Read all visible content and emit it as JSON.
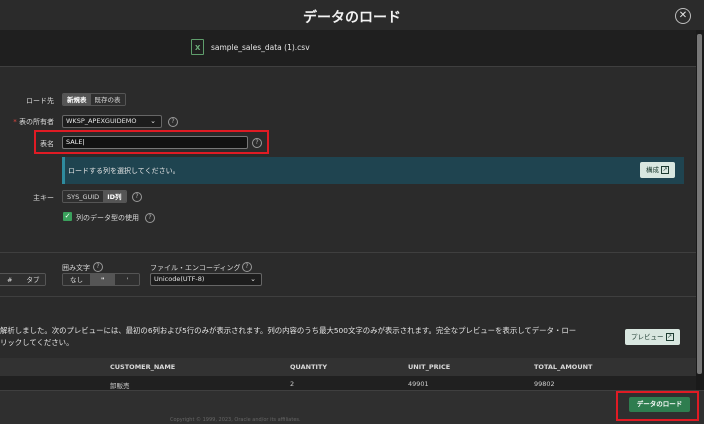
{
  "dialog": {
    "title": "データのロード",
    "close_glyph": "✕"
  },
  "file": {
    "name": "sample_sales_data (1).csv",
    "icon": "excel-file-icon",
    "icon_glyph": "X"
  },
  "load_to": {
    "label": "ロード先",
    "options": [
      "新規表",
      "既存の表"
    ],
    "selected": "新規表"
  },
  "owner": {
    "required_mark": "*",
    "label": "表の所有者",
    "value": "WKSP_APEXGUIDEMO"
  },
  "table_name": {
    "label": "表名",
    "value": "SALE"
  },
  "banner": {
    "text": "ロードする列を選択してください。",
    "button": "構成"
  },
  "primary_key": {
    "label": "主キー",
    "options": [
      "SYS_GUID",
      "ID列"
    ],
    "selected": "ID列"
  },
  "use_types": {
    "label": "列のデータ型の使用",
    "checked": true
  },
  "separator": {
    "options": [
      "#",
      "タブ"
    ]
  },
  "enclosed": {
    "label": "囲み文字",
    "options": [
      "なし",
      "\"",
      "'"
    ],
    "selected": "\""
  },
  "encoding": {
    "label": "ファイル・エンコーディング",
    "value": "Unicode(UTF-8)"
  },
  "parse": {
    "line1": "解析しました。次のプレビューには、最初の6列および5行のみが表示されます。列の内容のうち最大500文字のみが表示されます。完全なプレビューを表示してデータ・ロー",
    "line2": "リックしてください。",
    "preview_button": "プレビュー"
  },
  "table": {
    "columns": [
      "CUSTOMER_NAME",
      "QUANTITY",
      "UNIT_PRICE",
      "TOTAL_AMOUNT"
    ],
    "rows": [
      [
        "卸販売",
        "2",
        "49901",
        "99802"
      ]
    ]
  },
  "footer": {
    "load_button": "データのロード",
    "copyright": "Copyright © 1999, 2023, Oracle and/or its affiliates."
  },
  "colors": {
    "accent_green": "#2e7d4f",
    "highlight_red": "#e01b24",
    "banner_bg": "#1f4450"
  }
}
